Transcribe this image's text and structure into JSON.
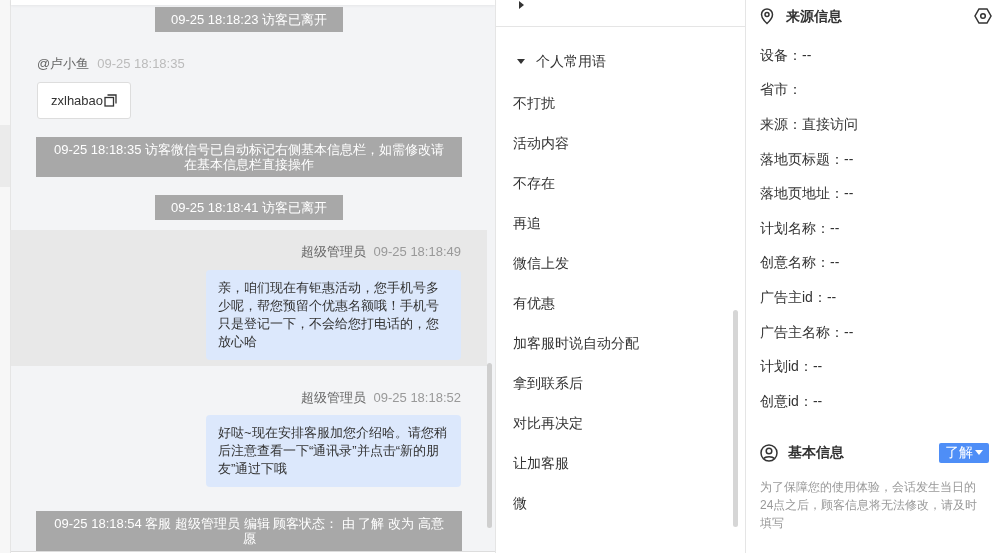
{
  "chat": {
    "messages": [
      {
        "kind": "notice",
        "text": "09-25 18:18:23 访客已离开"
      },
      {
        "kind": "visitor",
        "sender": "@卢小鱼",
        "time": "09-25 18:18:35",
        "text": "zxlhabao"
      },
      {
        "kind": "notice",
        "text": "09-25 18:18:35 访客微信号已自动标记右侧基本信息栏，如需修改请在基本信息栏直接操作"
      },
      {
        "kind": "notice",
        "text": "09-25 18:18:41 访客已离开"
      },
      {
        "kind": "agent",
        "sender": "超级管理员",
        "time": "09-25 18:18:49",
        "text": "亲，咱们现在有钜惠活动，您手机号多少呢，帮您预留个优惠名额哦！手机号只是登记一下，不会给您打电话的，您放心哈",
        "highlighted": true
      },
      {
        "kind": "agent",
        "sender": "超级管理员",
        "time": "09-25 18:18:52",
        "text": "好哒~现在安排客服加您介绍哈。请您稍后注意查看一下“通讯录”并点击“新的朋友”通过下哦",
        "highlighted": false
      },
      {
        "kind": "notice",
        "text": "09-25 18:18:54 客服 超级管理员 编辑 顾客状态： 由 了解 改为 高意愿"
      }
    ]
  },
  "phrases": {
    "team_group": {
      "expanded": false
    },
    "personal_group": {
      "title": "个人常用语",
      "expanded": true
    },
    "items": [
      "不打扰",
      "活动内容",
      "不存在",
      "再追",
      "微信上发",
      "有优惠",
      "加客服时说自动分配",
      "拿到联系后",
      "对比再决定",
      "让加客服",
      "微"
    ]
  },
  "source_info": {
    "title": "来源信息",
    "fields": [
      "设备：--",
      "省市：",
      "来源：直接访问",
      "落地页标题：--",
      "落地页地址：--",
      "计划名称：--",
      "创意名称：--",
      "广告主id：--",
      "广告主名称：--",
      "计划id：--",
      "创意id：--"
    ]
  },
  "basic_info": {
    "title": "基本信息",
    "status": "了解",
    "note": "为了保障您的使用体验，会话发生当日的24点之后，顾客信息将无法修改，请及时填写"
  }
}
